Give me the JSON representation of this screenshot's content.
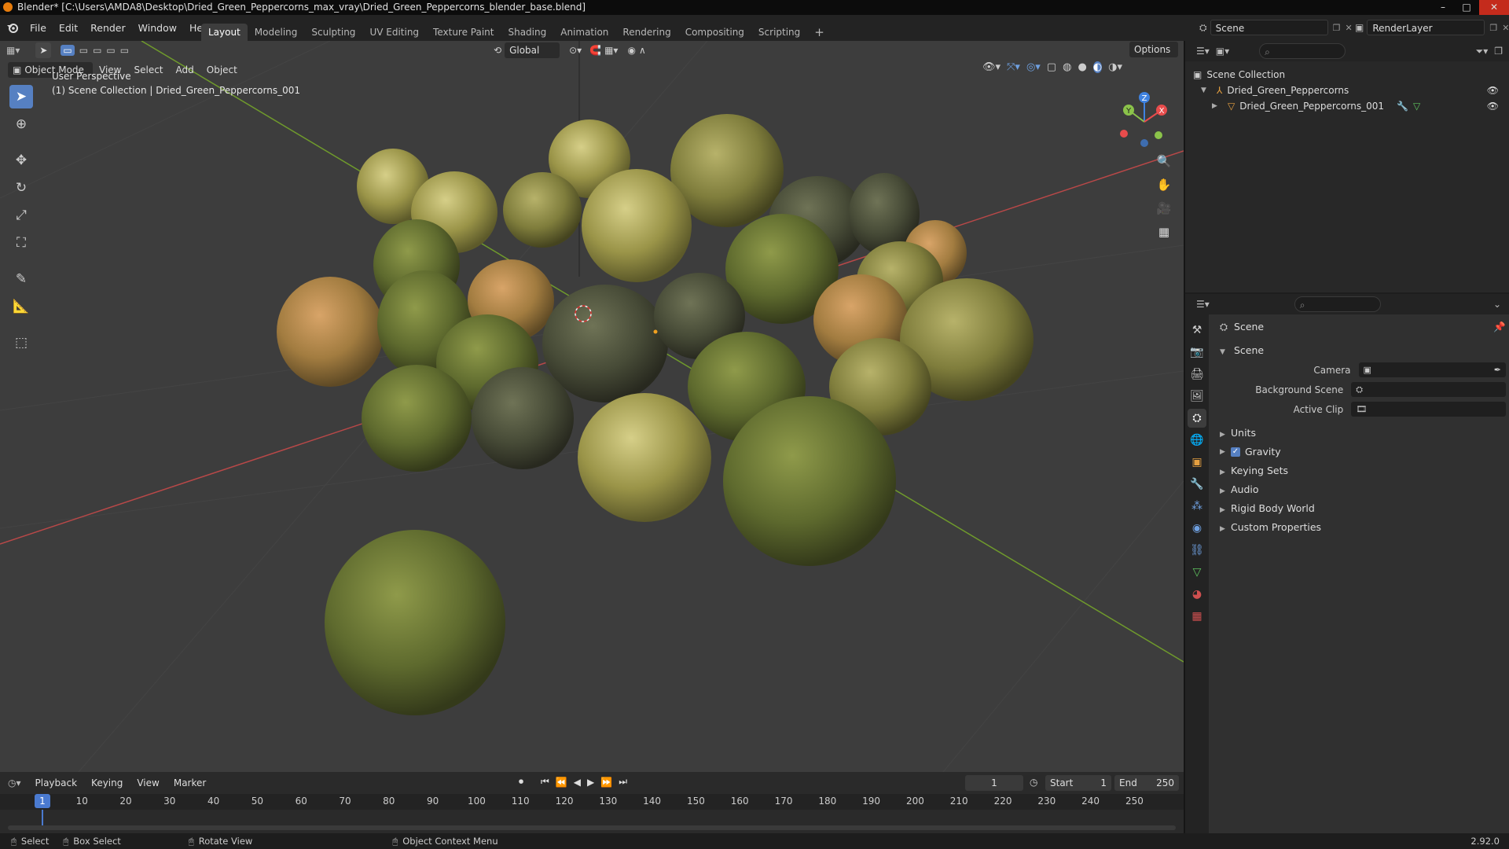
{
  "window": {
    "title": "Blender* [C:\\Users\\AMDA8\\Desktop\\Dried_Green_Peppercorns_max_vray\\Dried_Green_Peppercorns_blender_base.blend]",
    "minimize": "–",
    "maximize": "□",
    "close": "✕"
  },
  "menu": [
    "File",
    "Edit",
    "Render",
    "Window",
    "Help"
  ],
  "workspaces": [
    "Layout",
    "Modeling",
    "Sculpting",
    "UV Editing",
    "Texture Paint",
    "Shading",
    "Animation",
    "Rendering",
    "Compositing",
    "Scripting"
  ],
  "workspace_add": "+",
  "scene_name": "Scene",
  "render_layer": "RenderLayer",
  "tool_header": {
    "transform_orientation": "Global",
    "options_label": "Options"
  },
  "viewport_header": {
    "mode": "Object Mode",
    "menus": [
      "View",
      "Select",
      "Add",
      "Object"
    ]
  },
  "viewport_overlay": {
    "line1": "User Perspective",
    "line2": "(1) Scene Collection | Dried_Green_Peppercorns_001"
  },
  "gizmo": {
    "z": "Z",
    "y": "Y",
    "x": "X"
  },
  "outliner": {
    "root": "Scene Collection",
    "collection": "Dried_Green_Peppercorns",
    "object": "Dried_Green_Peppercorns_001"
  },
  "properties": {
    "header": "Scene",
    "panel": "Scene",
    "fields": {
      "camera": "Camera",
      "background_scene": "Background Scene",
      "active_clip": "Active Clip"
    },
    "subpanels": [
      "Units",
      "Gravity",
      "Keying Sets",
      "Audio",
      "Rigid Body World",
      "Custom Properties"
    ],
    "gravity_checked": true
  },
  "timeline": {
    "menus": [
      "Playback",
      "Keying",
      "View",
      "Marker"
    ],
    "current_frame": "1",
    "start_label": "Start",
    "start": "1",
    "end_label": "End",
    "end": "250",
    "ticks": [
      "1",
      "10",
      "20",
      "30",
      "40",
      "50",
      "60",
      "70",
      "80",
      "90",
      "100",
      "110",
      "120",
      "130",
      "140",
      "150",
      "160",
      "170",
      "180",
      "190",
      "200",
      "210",
      "220",
      "230",
      "240",
      "250"
    ],
    "playhead_frame": 1
  },
  "statusbar": {
    "select": "Select",
    "box_select": "Box Select",
    "rotate_view": "Rotate View",
    "context_menu": "Object Context Menu",
    "version": "2.92.0"
  },
  "colors": {
    "accent_blue": "#5680c2",
    "axis_x": "#e84c4c",
    "axis_y": "#8bc34a",
    "axis_z": "#3f82e0"
  }
}
